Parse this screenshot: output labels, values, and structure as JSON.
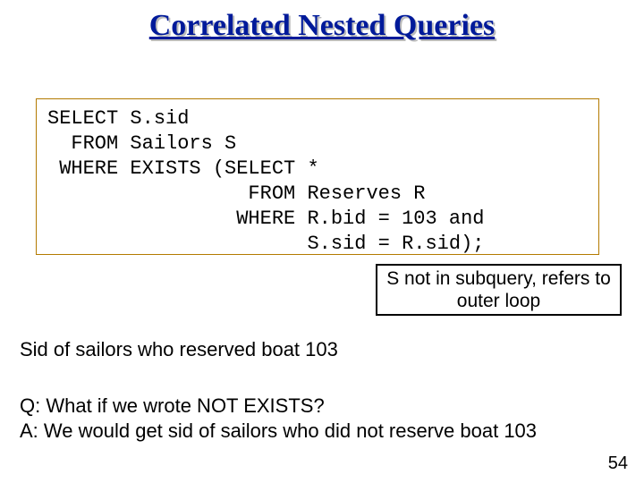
{
  "title": "Correlated Nested Queries",
  "sql": {
    "l1": "SELECT S.sid",
    "l2": "  FROM Sailors S",
    "l3": " WHERE EXISTS (SELECT *",
    "l4": "                 FROM Reserves R",
    "l5": "                WHERE R.bid = 103 and",
    "l6": "                      S.sid = R.sid);"
  },
  "callout": "S not in subquery, refers to outer loop",
  "description": "Sid of sailors who reserved boat 103",
  "qa": {
    "q": "Q: What if we wrote NOT EXISTS?",
    "a": "A: We would get sid of sailors who did not reserve boat 103"
  },
  "page_number": "54"
}
